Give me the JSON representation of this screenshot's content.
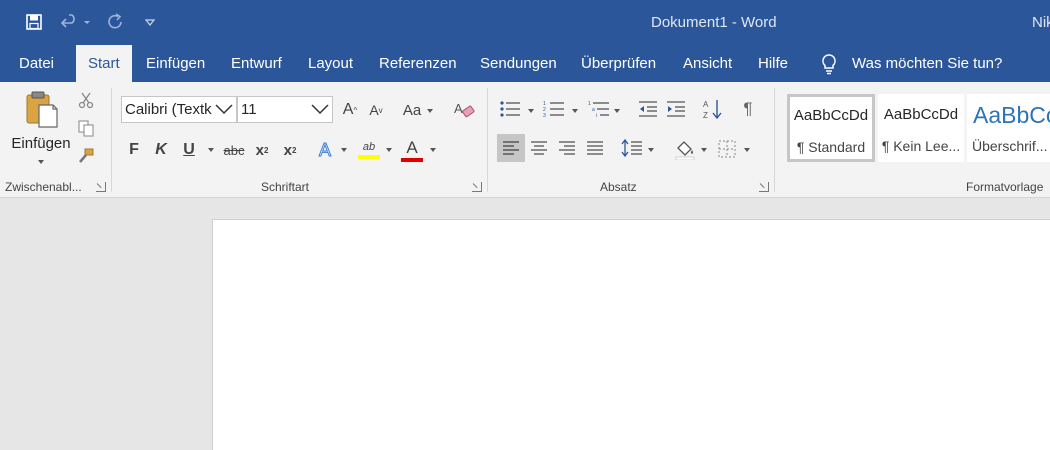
{
  "window": {
    "title": "Dokument1  -  Word",
    "user_name": "Nik"
  },
  "quick_access": {
    "icons": [
      "save-icon",
      "undo-icon",
      "redo-icon",
      "customize-icon"
    ]
  },
  "tabs": [
    {
      "label": "Datei",
      "active": false
    },
    {
      "label": "Start",
      "active": true
    },
    {
      "label": "Einfügen",
      "active": false
    },
    {
      "label": "Entwurf",
      "active": false
    },
    {
      "label": "Layout",
      "active": false
    },
    {
      "label": "Referenzen",
      "active": false
    },
    {
      "label": "Sendungen",
      "active": false
    },
    {
      "label": "Überprüfen",
      "active": false
    },
    {
      "label": "Ansicht",
      "active": false
    },
    {
      "label": "Hilfe",
      "active": false
    }
  ],
  "tell_me": {
    "label": "Was möchten Sie tun?"
  },
  "ribbon": {
    "clipboard": {
      "paste_label": "Einfügen",
      "group_label": "Zwischenabl..."
    },
    "font": {
      "font_name": "Calibri (Textk",
      "font_size": "11",
      "change_case_label": "Aa",
      "bold_label": "F",
      "italic_label": "K",
      "underline_label": "U",
      "strike_label": "abc",
      "subscript_label": "x",
      "superscript_label": "x",
      "highlight_label": "ab",
      "font_color_label": "A",
      "highlight_color": "#ffff00",
      "font_color": "#e00000",
      "group_label": "Schriftart"
    },
    "paragraph": {
      "group_label": "Absatz"
    },
    "styles": {
      "items": [
        {
          "preview": "AaBbCcDd",
          "name": "¶ Standard"
        },
        {
          "preview": "AaBbCcDd",
          "name": "¶ Kein Lee..."
        },
        {
          "preview": "AaBbCc",
          "name": "Überschrif..."
        }
      ],
      "group_label": "Formatvorlage"
    }
  },
  "colors": {
    "accent": "#2b579a",
    "ribbon_bg": "#f3f3f3",
    "workspace_bg": "#e6e6e6"
  }
}
